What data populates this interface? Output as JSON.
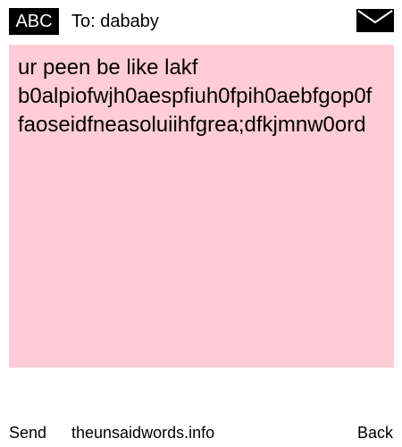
{
  "header": {
    "mode_badge": "ABC",
    "to_line": "To: dababy",
    "compose_icon": "envelope-icon"
  },
  "message": {
    "line1": "ur peen be like lakf",
    "line2": "b0alpiofwjh0aespfiuh0fpih0aebfgop0f",
    "line3": "faoseidfneasoluiihfgrea;dfkjmnw0ord",
    "background": "#ffccd7"
  },
  "footer": {
    "send_label": "Send",
    "site_label": "theunsaidwords.info",
    "back_label": "Back"
  }
}
